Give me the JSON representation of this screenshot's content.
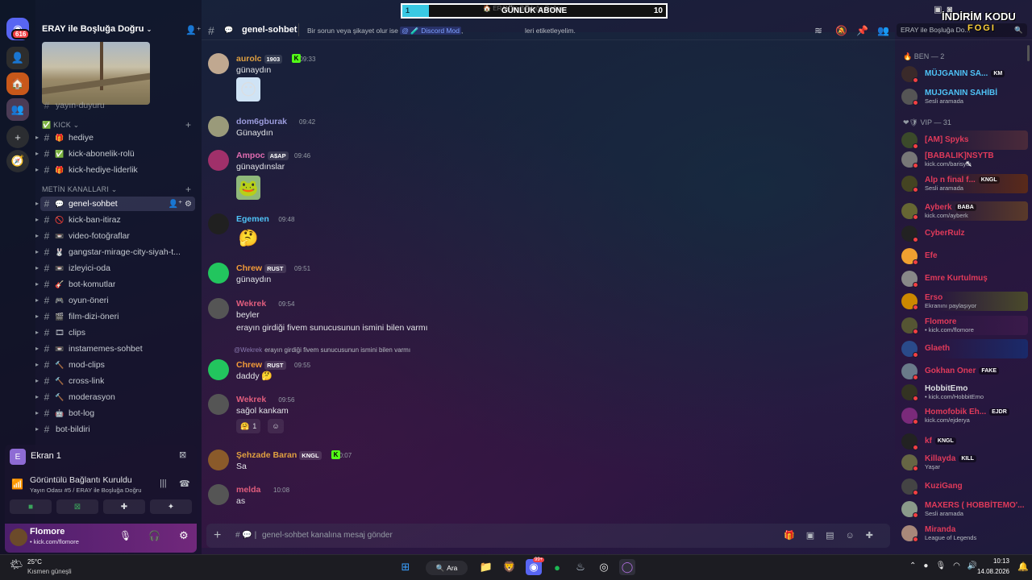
{
  "server": {
    "name": "ERAY ile Boşluğa Doğru",
    "badge": "616",
    "partial_channel": "yayın-duyuru"
  },
  "categories": [
    {
      "label": "Kick"
    },
    {
      "label": "METİN KANALLARI"
    }
  ],
  "channels_kick": [
    {
      "label": "hediye",
      "emoji": "🎁"
    },
    {
      "label": "kick-abonelik-rolü",
      "emoji": "✅"
    },
    {
      "label": "kick-hediye-liderlik",
      "emoji": "🎁"
    }
  ],
  "channels_text": [
    {
      "label": "genel-sohbet",
      "emoji": "💬",
      "active": true
    },
    {
      "label": "kick-ban-itiraz",
      "emoji": "🚫"
    },
    {
      "label": "video-fotoğraflar",
      "emoji": "📼"
    },
    {
      "label": "gangstar-mirage-city-siyah-t...",
      "emoji": "🐰"
    },
    {
      "label": "izleyici-oda",
      "emoji": "📼"
    },
    {
      "label": "bot-komutlar",
      "emoji": "🎸"
    },
    {
      "label": "oyun-öneri",
      "emoji": "🎮"
    },
    {
      "label": "film-dizi-öneri",
      "emoji": "🎬"
    },
    {
      "label": "clips",
      "emoji": "🎞"
    },
    {
      "label": "instamemes-sohbet",
      "emoji": "📼"
    },
    {
      "label": "mod-clips",
      "emoji": "🔨"
    },
    {
      "label": "cross-link",
      "emoji": "🔨"
    },
    {
      "label": "moderasyon",
      "emoji": "🔨"
    },
    {
      "label": "bot-log",
      "emoji": "🤖"
    },
    {
      "label": "bot-bildiri",
      "emoji": ""
    }
  ],
  "screen": {
    "label": "Ekran 1",
    "initial": "E"
  },
  "voice": {
    "status": "Görüntülü Bağlantı Kuruldu",
    "location": "Yayın Odası #5 / ERAY ile Boşluğa Doğru"
  },
  "current_user": {
    "name": "Flomore",
    "status": "• kick.com/flomore"
  },
  "header": {
    "channel": "genel-sohbet",
    "topic_1": "Bir sorun veya şikayet olur ise",
    "mention": "@ 🧪 Discord Mod",
    "comma": ",",
    "topic_2": "leri etiketleyelim.",
    "search_placeholder": "ERAY ile Boşluğa Do..."
  },
  "messages": [
    {
      "user": "aurolc",
      "tag": "1903",
      "time": "09:33",
      "text": "günaydın",
      "color": "#e0a040"
    },
    {
      "user": "dom6gburak",
      "tag": "",
      "time": "09:42",
      "text": "Günaydın",
      "color": "#9b9bdc"
    },
    {
      "user": "Ampoc",
      "tag": "A$AP",
      "time": "09:46",
      "text": "günaydınslar",
      "color": "#e06cb0"
    },
    {
      "user": "Egemen",
      "tag": "",
      "time": "09:48",
      "text": "",
      "color": "#4fc3f7"
    },
    {
      "user": "Chrew",
      "tag": "RUST",
      "time": "09:51",
      "text": "günaydın",
      "color": "#f29b38"
    },
    {
      "user": "Wekrek",
      "tag": "",
      "time": "09:54",
      "text": "beyler",
      "text2": "erayın girdiği fivem sunucusunun ismini bilen varmı",
      "color": "#e05d7d"
    },
    {
      "user": "Chrew",
      "tag": "RUST",
      "time": "09:55",
      "text": "daddy",
      "reply_user": "@Wekrek",
      "reply_text": "erayın girdiği fivem sunucusunun ismini bilen varmı",
      "color": "#f29b38"
    },
    {
      "user": "Wekrek",
      "tag": "",
      "time": "09:56",
      "text": "sağol kankam",
      "reaction_count": "1",
      "color": "#e05d7d"
    },
    {
      "user": "Şehzade Baran",
      "tag": "KNGL",
      "time": "10:07",
      "text": "Sa",
      "color": "#e0a040"
    },
    {
      "user": "melda",
      "tag": "",
      "time": "10:08",
      "text": "as",
      "color": "#e05d7d"
    }
  ],
  "input": {
    "placeholder": "genel-sohbet kanalına mesaj gönder"
  },
  "member_groups": [
    {
      "label": "BEN — 2"
    },
    {
      "label": "VIP — 31"
    }
  ],
  "members": [
    {
      "name": "MÜJGANIN SA...",
      "status": "",
      "tag": "KM",
      "color": "#4fc3f7",
      "av": "#3a2a2a"
    },
    {
      "name": "MUJGANIN SAHİBİ",
      "status": "Sesli aramada",
      "tag": "",
      "color": "#4fc3f7",
      "av": "#555"
    },
    {
      "name": "[AM] Spyks",
      "status": "",
      "tag": "",
      "color": "#e03a5a",
      "av": "#3b4a2a"
    },
    {
      "name": "[BABALIK]NSYTB",
      "status": "kick.com/barisytb",
      "tag": "",
      "color": "#e03a5a",
      "av": "#777"
    },
    {
      "name": "Alp n final f...",
      "status": "Sesli aramada",
      "tag": "KNGL",
      "color": "#e03a5a",
      "av": "#442"
    },
    {
      "name": "Ayberk",
      "status": "kick.com/ayberk",
      "tag": "BABA",
      "color": "#e03a5a",
      "av": "#663"
    },
    {
      "name": "CyberRulz",
      "status": "",
      "tag": "",
      "color": "#e03a5a",
      "av": "#222"
    },
    {
      "name": "Efe",
      "status": "",
      "tag": "",
      "color": "#e03a5a",
      "av": "#f0a030"
    },
    {
      "name": "Emre Kurtulmuş",
      "status": "",
      "tag": "",
      "color": "#e03a5a",
      "av": "#888"
    },
    {
      "name": "Erso",
      "status": "Ekranını paylaşıyor",
      "tag": "",
      "color": "#e03a5a",
      "av": "#c80"
    },
    {
      "name": "Flomore",
      "status": "• kick.com/flomore",
      "tag": "",
      "color": "#e03a5a",
      "av": "#553"
    },
    {
      "name": "Glaeth",
      "status": "",
      "tag": "",
      "color": "#e03a5a",
      "av": "#2a4a8a"
    },
    {
      "name": "Gokhan Oner",
      "status": "",
      "tag": "FAKE",
      "color": "#e03a5a",
      "av": "#6a7a8a"
    },
    {
      "name": "HobbitEmo",
      "status": "• kick.com/HobbitEmo",
      "tag": "",
      "color": "#dbdee1",
      "av": "#332"
    },
    {
      "name": "Homofobik Eh...",
      "status": "kick.com/ejderya",
      "tag": "EJDR",
      "color": "#e03a5a",
      "av": "#7a2a7a"
    },
    {
      "name": "kf",
      "status": "",
      "tag": "KNGL",
      "color": "#e03a5a",
      "av": "#222"
    },
    {
      "name": "Killayda",
      "status": "Yaşar",
      "tag": "KILL",
      "color": "#e03a5a",
      "av": "#664"
    },
    {
      "name": "KuziGang",
      "status": "",
      "tag": "",
      "color": "#e03a5a",
      "av": "#444"
    },
    {
      "name": "MAXERS ( HOBBİTEMO'...",
      "status": "Sesli aramada",
      "tag": "",
      "color": "#e03a5a",
      "av": "#8a9a8a"
    },
    {
      "name": "Miranda",
      "status": "League of Legends",
      "tag": "",
      "color": "#e03a5a",
      "av": "#a8887a"
    }
  ],
  "overlay": {
    "sub_title": "GÜNLÜK ABONE",
    "sub_left": "1",
    "sub_right": "10",
    "sub_fraction": 0.1,
    "sub_behind": "ERAY ile Boşluğa Doğru",
    "promo": "İNDİRİM KODU",
    "promo2": "FOGI"
  },
  "taskbar": {
    "temp": "25°C",
    "weather": "Kısmen güneşli",
    "search": "Ara",
    "badge": "99+",
    "time": "10:13",
    "date": "14.08.2026"
  }
}
